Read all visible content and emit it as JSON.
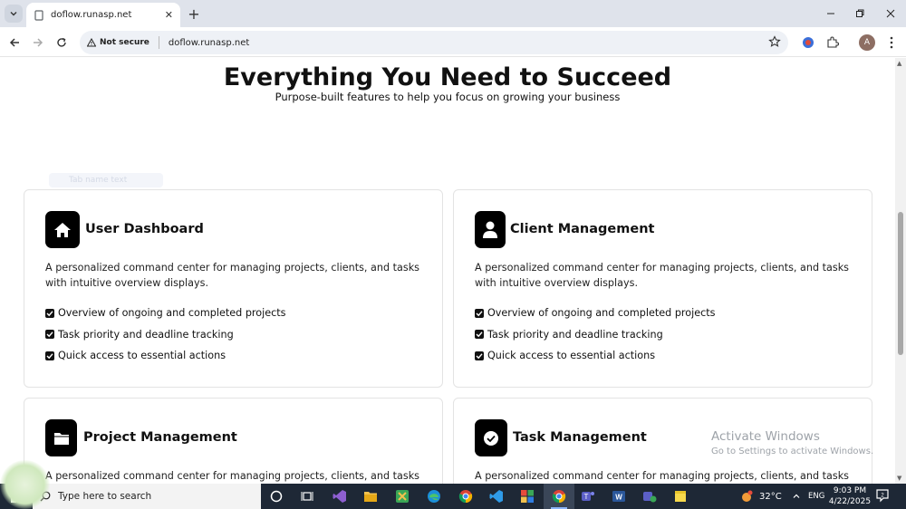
{
  "browser": {
    "tab_title": "doflow.runasp.net",
    "tab_close": "✕",
    "new_tab": "+",
    "security_label": "Not secure",
    "url": "doflow.runasp.net",
    "avatar_letter": "A"
  },
  "page": {
    "title": "Everything You Need to Succeed",
    "subtitle": "Purpose-built features to help you focus on growing your business",
    "faded_tab": "Tab name text"
  },
  "cards": [
    {
      "title": "User Dashboard",
      "icon": "home-icon",
      "description": "A personalized command center for managing projects, clients, and tasks with intuitive overview displays.",
      "features": [
        "Overview of ongoing and completed projects",
        "Task priority and deadline tracking",
        "Quick access to essential actions"
      ]
    },
    {
      "title": "Client Management",
      "icon": "user-icon",
      "description": "A personalized command center for managing projects, clients, and tasks with intuitive overview displays.",
      "features": [
        "Overview of ongoing and completed projects",
        "Task priority and deadline tracking",
        "Quick access to essential actions"
      ]
    },
    {
      "title": "Project Management",
      "icon": "folder-icon",
      "description": "A personalized command center for managing projects, clients, and tasks with"
    },
    {
      "title": "Task Management",
      "icon": "check-circle-icon",
      "description": "A personalized command center for managing projects, clients, and tasks with"
    }
  ],
  "watermark": {
    "line1": "Activate Windows",
    "line2": "Go to Settings to activate Windows."
  },
  "taskbar": {
    "search_placeholder": "Type here to search",
    "temperature": "32°C",
    "language": "ENG",
    "time": "9:03 PM",
    "date": "4/22/2025"
  },
  "colors": {
    "card_icon_bg": "#000000",
    "taskbar_bg": "#1e2836",
    "tabbar_bg": "#dfe3eb"
  }
}
